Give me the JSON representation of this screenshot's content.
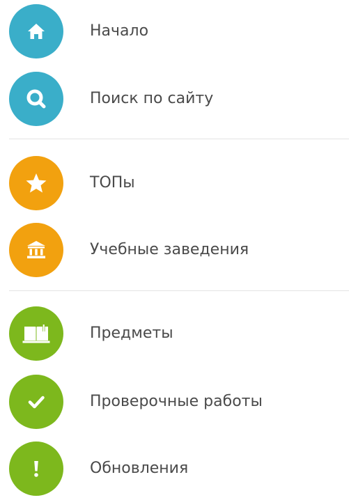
{
  "colors": {
    "blue": "#3aaec9",
    "orange": "#f2a10f",
    "green": "#7db81d",
    "icon": "#ffffff",
    "label": "#4a4a4a",
    "divider": "#e3e3e3"
  },
  "menu": {
    "items": [
      {
        "label": "Начало",
        "icon": "home-icon",
        "color": "blue"
      },
      {
        "label": "Поиск по сайту",
        "icon": "search-icon",
        "color": "blue"
      },
      {
        "label": "ТОПы",
        "icon": "star-icon",
        "color": "orange"
      },
      {
        "label": "Учебные заведения",
        "icon": "institution-icon",
        "color": "orange"
      },
      {
        "label": "Предметы",
        "icon": "book-icon",
        "color": "green"
      },
      {
        "label": "Проверочные работы",
        "icon": "check-icon",
        "color": "green"
      },
      {
        "label": "Обновления",
        "icon": "exclamation-icon",
        "color": "green"
      }
    ]
  }
}
